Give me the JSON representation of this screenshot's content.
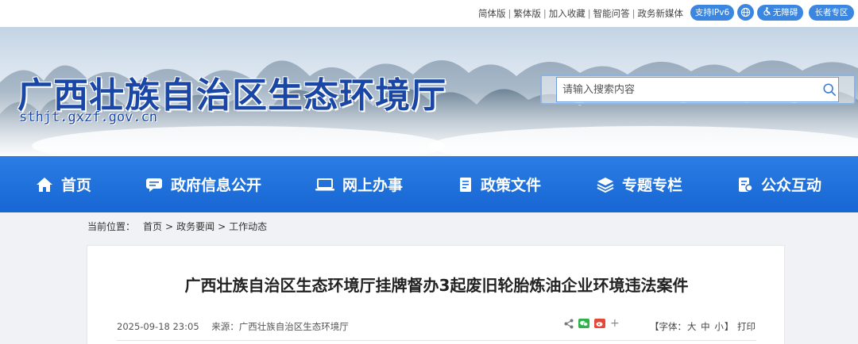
{
  "topbar": {
    "links": [
      "简体版",
      "繁体版",
      "加入收藏",
      "智能问答",
      "政务新媒体"
    ],
    "separator": "|",
    "ipv6": "支持IPv6",
    "accessibility": "无障碍",
    "senior": "长者专区"
  },
  "header": {
    "site_title": "广西壮族自治区生态环境厅",
    "site_url": "sthjt.gxzf.gov.cn",
    "search_placeholder": "请输入搜索内容"
  },
  "nav": {
    "items": [
      {
        "label": "首页",
        "icon": "home-icon"
      },
      {
        "label": "政府信息公开",
        "icon": "chat-icon"
      },
      {
        "label": "网上办事",
        "icon": "laptop-icon"
      },
      {
        "label": "政策文件",
        "icon": "document-icon"
      },
      {
        "label": "专题专栏",
        "icon": "layers-icon"
      },
      {
        "label": "公众互动",
        "icon": "interaction-icon"
      }
    ]
  },
  "breadcrumb": {
    "prefix": "当前位置：",
    "items": [
      "首页",
      "政务要闻",
      "工作动态"
    ],
    "separator": ">"
  },
  "article": {
    "title": "广西壮族自治区生态环境厅挂牌督办3起废旧轮胎炼油企业环境违法案件",
    "datetime": "2025-09-18 23:05",
    "source_label": "来源：",
    "source": "广西壮族自治区生态环境厅",
    "font_label": "【字体：",
    "font_sizes": [
      "大",
      "中",
      "小"
    ],
    "font_close": "】",
    "print": "打印"
  },
  "colors": {
    "brand_blue": "#1766d4",
    "title_blue": "#1a47a6",
    "pill_blue": "#3a86e0"
  }
}
